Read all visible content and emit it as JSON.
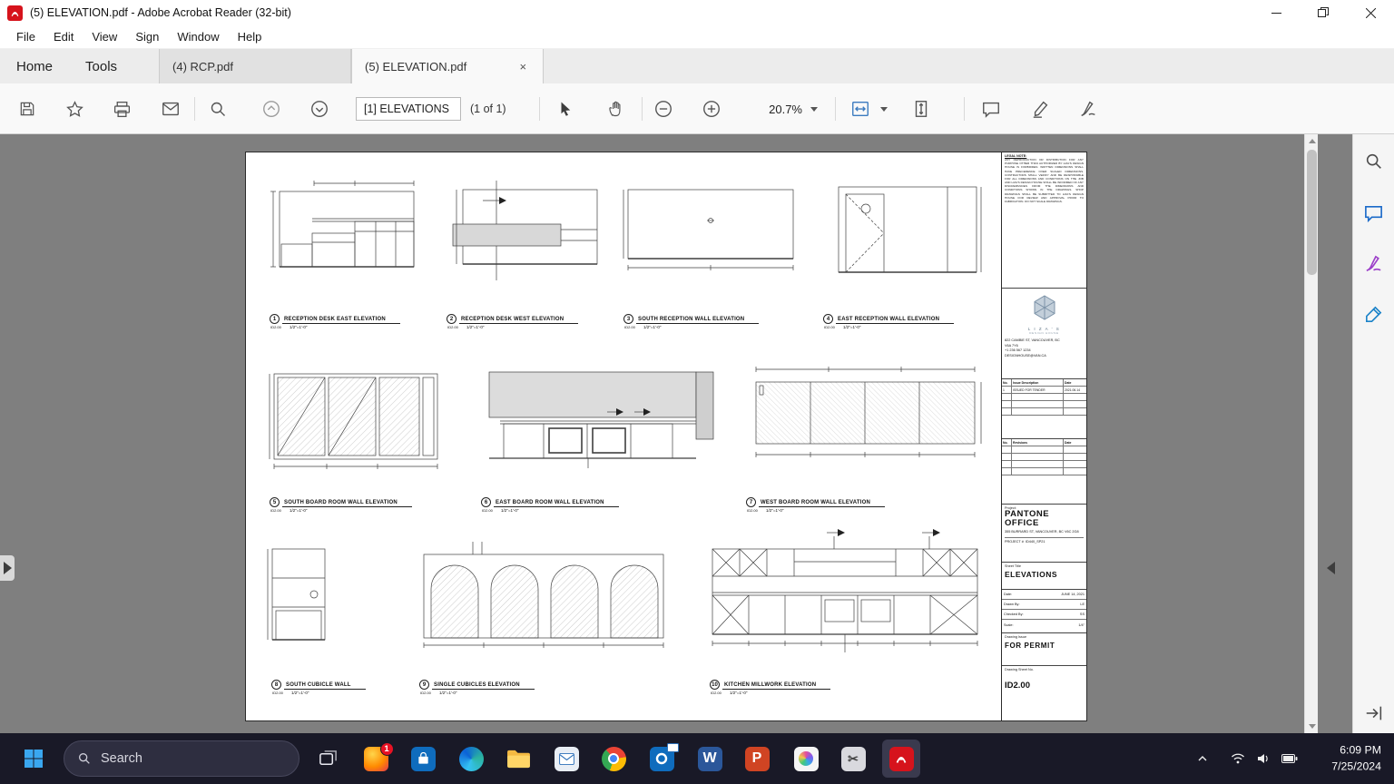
{
  "window": {
    "title": "(5) ELEVATION.pdf - Adobe Acrobat Reader (32-bit)"
  },
  "menubar": {
    "items": [
      "File",
      "Edit",
      "View",
      "Sign",
      "Window",
      "Help"
    ]
  },
  "tabbar": {
    "home": "Home",
    "tools": "Tools",
    "tab1": "(4) RCP.pdf",
    "tab2": "(5) ELEVATION.pdf"
  },
  "toolbar": {
    "page_field": "[1] ELEVATIONS",
    "page_count": "(1 of 1)",
    "zoom_level": "20.7%"
  },
  "sheet": {
    "elevations": [
      {
        "num": "1",
        "title": "RECEPTION DESK EAST ELEVATION",
        "ref": "ID2.00",
        "scale": "1/2\"=1'-0\""
      },
      {
        "num": "2",
        "title": "RECEPTION DESK WEST ELEVATION",
        "ref": "ID2.00",
        "scale": "1/2\"=1'-0\""
      },
      {
        "num": "3",
        "title": "SOUTH  RECEPTION WALL  ELEVATION",
        "ref": "ID2.00",
        "scale": "1/2\"=1'-0\""
      },
      {
        "num": "4",
        "title": "EAST RECEPTION WALL  ELEVATION",
        "ref": "ID2.00",
        "scale": "1/2\"=1'-0\""
      },
      {
        "num": "5",
        "title": "SOUTH BOARD ROOM WALL ELEVATION",
        "ref": "ID2.00",
        "scale": "1/2\"=1'-0\""
      },
      {
        "num": "6",
        "title": "EAST BOARD ROOM WALL ELEVATION",
        "ref": "ID2.00",
        "scale": "1/2\"=1'-0\""
      },
      {
        "num": "7",
        "title": "WEST BOARD ROOM WALL ELEVATION",
        "ref": "ID2.00",
        "scale": "1/2\"=1'-0\""
      },
      {
        "num": "8",
        "title": "SOUTH CUBICLE WALL",
        "ref": "ID2.00",
        "scale": "1/2\"=1'-0\""
      },
      {
        "num": "9",
        "title": "SINGLE CUBICLES ELEVATION",
        "ref": "ID2.00",
        "scale": "1/2\"=1'-0\""
      },
      {
        "num": "10",
        "title": "KITCHEN MILLWORK ELEVATION",
        "ref": "ID2.00",
        "scale": "1/2\"=1'-0\""
      }
    ],
    "titleblock": {
      "legal_heading": "LEGAL NOTE:",
      "legal_body": "ANY REPRODUCTION OR DISTRIBUTION FOR ANY PURPOSE OTHER THAN AUTHORIZED BY LIZA'S DESIGN HOUSE IS FORBIDDEN. WRITTEN DIMENSIONS SHALL HAVE PRECEDENCE OVER SCALED DIMENSIONS. CONTRACTORS SHALL VERIFY AND BE RESPONSIBLE FOR ALL DIMENSIONS AND CONDITIONS ON THE JOB AND LIZA'S DESIGN HOUSE SHALL BE INFORMED OF ANY DISCREPANCIES FROM THE DIMENSIONS AND CONDITIONS SHOWN IN THE DRAWINGS. SHOP DRAWINGS SHALL BE SUBMITTED TO LIZA'S DESIGN HOUSE FOR REVIEW AND APPROVAL PRIOR TO FABRICATION. DO NOT SCALE DRAWINGS.",
      "brand": "L I Z A ' S",
      "brand_sub": "DESIGN HOUSE",
      "address": "822 CAMBIE ST, VANCOUVER, BC",
      "postal": "V6A 7Y6",
      "phone": "+1 236 567 1234",
      "email": "DESIGNHOUSE@VAN.CA",
      "issue_headers": [
        "No.",
        "Issue Description",
        "Date"
      ],
      "issue_row": [
        "1",
        "ISSUED FOR TENDER",
        "2021.06.14"
      ],
      "rev_headers": [
        "No.",
        "Revisions",
        "Date"
      ],
      "project_label": "Project:",
      "project_name_1": "PANTONE",
      "project_name_2": "OFFICE",
      "project_address": "355 BURRARD ST,  VANCOUVER, BC V6C 2G8",
      "project_no_label": "PROJECT #",
      "project_no": "ID440_SP21",
      "sheet_title_label": "Sheet Title",
      "sheet_title": "ELEVATIONS",
      "date_label": "Date:",
      "date": "JUNE 14, 2021",
      "drawn_label": "Drawn By:",
      "drawn": "LE",
      "checked_label": "Checked By:",
      "checked": "SS",
      "scale_label": "Scale:",
      "scale": "1/4\"",
      "issue_label": "Drawing Issue",
      "issue_value": "FOR  PERMIT",
      "sheet_no_label": "Drawing Sheet No.",
      "sheet_no": "ID2.00"
    }
  },
  "taskbar": {
    "search_placeholder": "Search",
    "badge": "1",
    "word_letter": "W",
    "ppt_letter": "P",
    "time": "6:09 PM",
    "date": "7/25/2024"
  }
}
